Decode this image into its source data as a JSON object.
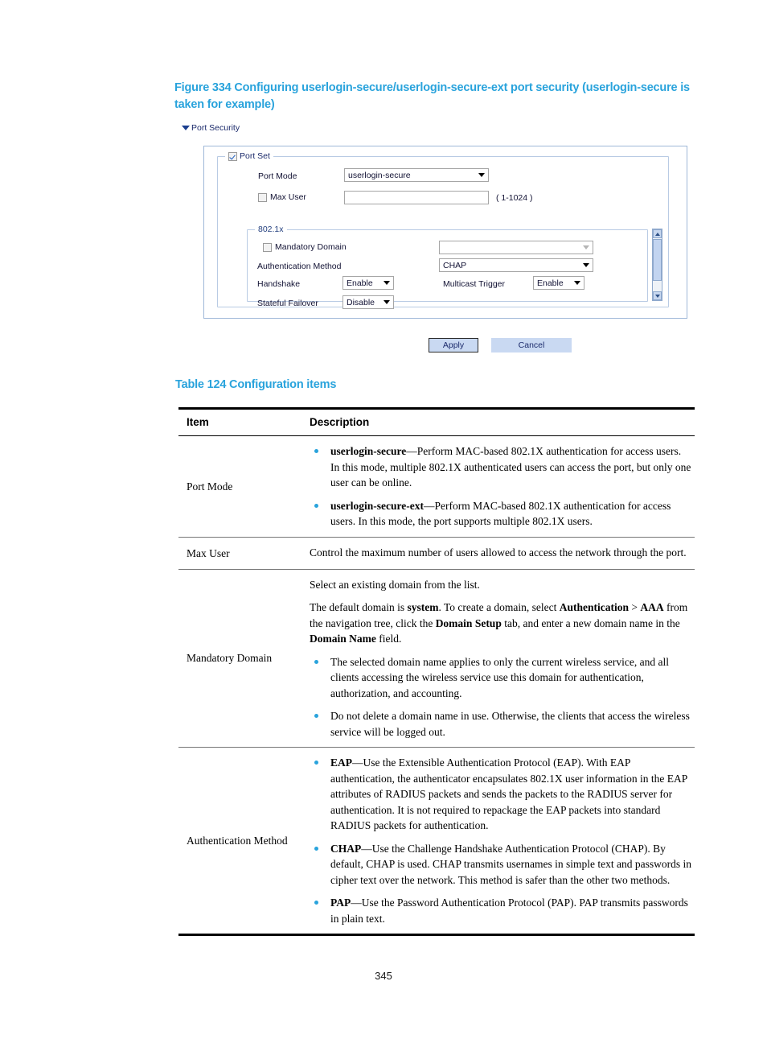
{
  "figure": {
    "caption": "Figure 334 Configuring userlogin-secure/userlogin-secure-ext port security (userlogin-secure is taken for example)",
    "panel_header": "Port Security",
    "groups": {
      "port_set_legend": "Port Set",
      "port_set_checked": true,
      "dot1x_legend": "802.1x"
    },
    "fields": {
      "port_mode_label": "Port Mode",
      "port_mode_value": "userlogin-secure",
      "max_user_label": "Max User",
      "max_user_value": "",
      "max_user_hint": "( 1-1024 )",
      "mandatory_domain_label": "Mandatory Domain",
      "mandatory_domain_value": "",
      "auth_method_label": "Authentication Method",
      "auth_method_value": "CHAP",
      "handshake_label": "Handshake",
      "handshake_value": "Enable",
      "multicast_trigger_label": "Multicast Trigger",
      "multicast_trigger_value": "Enable",
      "stateful_failover_label": "Stateful Failover",
      "stateful_failover_value": "Disable"
    },
    "buttons": {
      "apply": "Apply",
      "cancel": "Cancel"
    }
  },
  "table": {
    "caption": "Table 124 Configuration items",
    "headers": {
      "item": "Item",
      "description": "Description"
    },
    "rows": {
      "port_mode": {
        "item": "Port Mode",
        "bullet1_term": "userlogin-secure",
        "bullet1_text": "—Perform MAC-based 802.1X authentication for access users. In this mode, multiple 802.1X authenticated users can access the port, but only one user can be online.",
        "bullet2_term": "userlogin-secure-ext",
        "bullet2_text": "—Perform MAC-based 802.1X authentication for access users. In this mode, the port supports multiple 802.1X users."
      },
      "max_user": {
        "item": "Max User",
        "text": "Control the maximum number of users allowed to access the network through the port."
      },
      "mandatory_domain": {
        "item": "Mandatory Domain",
        "para1": "Select an existing domain from the list.",
        "para2_a": "The default domain is ",
        "para2_b": "system",
        "para2_c": ". To create a domain, select ",
        "para2_d": "Authentication",
        "para2_e": " > ",
        "para2_f": "AAA",
        "para2_g": " from the navigation tree, click the ",
        "para2_h": "Domain Setup",
        "para2_i": " tab, and enter a new domain name in the ",
        "para2_j": "Domain Name",
        "para2_k": " field.",
        "bullet1": "The selected domain name applies to only the current wireless service, and all clients accessing the wireless service use this domain for authentication, authorization, and accounting.",
        "bullet2": "Do not delete a domain name in use. Otherwise, the clients that access the wireless service will be logged out."
      },
      "auth_method": {
        "item": "Authentication Method",
        "bullet1_term": "EAP",
        "bullet1_text": "—Use the Extensible Authentication Protocol (EAP). With EAP authentication, the authenticator encapsulates 802.1X user information in the EAP attributes of RADIUS packets and sends the packets to the RADIUS server for authentication. It is not required to repackage the EAP packets into standard RADIUS packets for authentication.",
        "bullet2_term": "CHAP",
        "bullet2_text": "—Use the Challenge Handshake Authentication Protocol (CHAP). By default, CHAP is used. CHAP transmits usernames in simple text and passwords in cipher text over the network. This method is safer than the other two methods.",
        "bullet3_term": "PAP",
        "bullet3_text": "—Use the Password Authentication Protocol (PAP). PAP transmits passwords in plain text."
      }
    }
  },
  "footer": {
    "page_number": "345"
  },
  "colors": {
    "heading_blue": "#29a3dc",
    "bullet_blue": "#29a3dc",
    "panel_border": "#9fb8d8",
    "button_fill": "#c9d9f2"
  }
}
